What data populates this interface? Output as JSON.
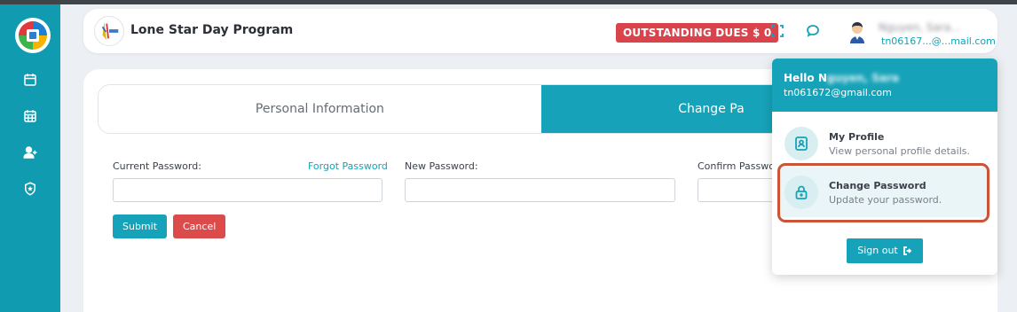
{
  "header": {
    "org_name": "Lone Star Day Program",
    "dues_label": "OUTSTANDING DUES $ 0",
    "user_name": "Nguyen, Sara...",
    "user_email": "tn06167...@...mail.com"
  },
  "tabs": {
    "personal": "Personal Information",
    "change": "Change Pa"
  },
  "form": {
    "current_label": "Current Password:",
    "forgot_label": "Forgot Password",
    "new_label": "New Password:",
    "confirm_label": "Confirm Passwor",
    "submit_label": "Submit",
    "cancel_label": "Cancel"
  },
  "dropdown": {
    "hello_prefix": "Hello N",
    "hello_blurred": "guyen, Sara",
    "email": "tn061672@gmail.com",
    "items": [
      {
        "title": "My Profile",
        "subtitle": "View personal profile details.",
        "icon": "profile-badge-icon"
      },
      {
        "title": "Change Password",
        "subtitle": "Update your password.",
        "icon": "lock-icon"
      }
    ],
    "signout_label": "Sign out"
  },
  "sidebar": {
    "items": [
      "calendar-icon",
      "calendar-grid-icon",
      "add-user-icon",
      "shield-icon"
    ]
  },
  "colors": {
    "accent": "#16a2b8",
    "sidebar": "#119bb0",
    "danger": "#d8434c",
    "highlight": "#cc5436"
  }
}
